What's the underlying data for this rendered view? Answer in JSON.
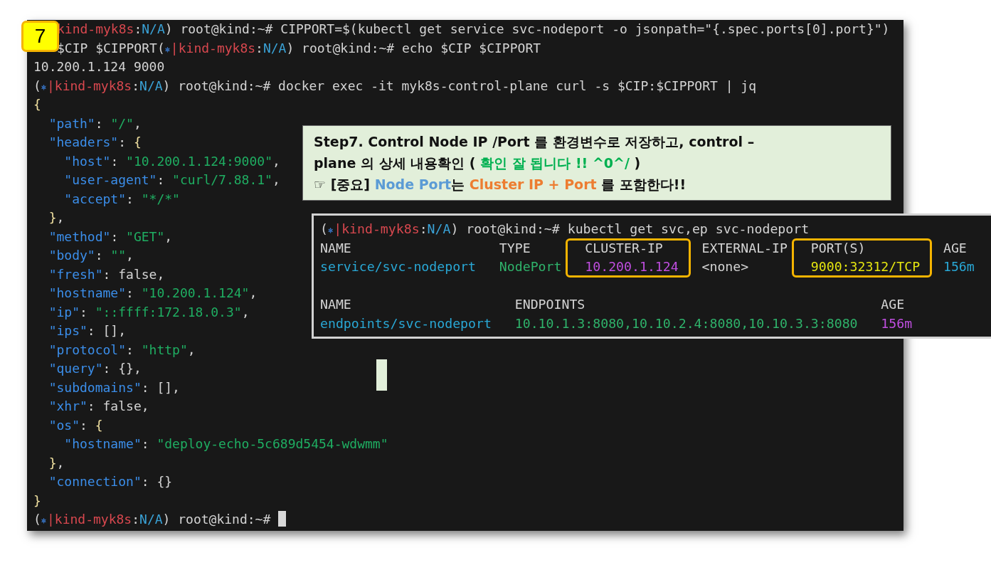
{
  "badge": {
    "text": "7"
  },
  "terminal": {
    "lines": [
      {
        "segments": [
          {
            "kind": "context",
            "text": "kind-myk8s"
          },
          {
            "kind": "plain",
            "text": ":"
          },
          {
            "kind": "ns",
            "text": "N/A"
          },
          {
            "kind": "plain",
            "text": ") root@kind:~# CIPPORT=$(kubectl get service svc-nodeport -o jsonpath=\"{.spec.ports[0].port}\")"
          }
        ]
      },
      {
        "segments": [
          {
            "kind": "plain",
            "text": "$CIP $CIPPORT("
          },
          {
            "kind": "helm",
            "text": "⎈"
          },
          {
            "kind": "sep",
            "text": "|"
          },
          {
            "kind": "context",
            "text": "kind-myk8s"
          },
          {
            "kind": "plain",
            "text": ":"
          },
          {
            "kind": "ns",
            "text": "N/A"
          },
          {
            "kind": "plain",
            "text": ") root@kind:~# echo $CIP $CIPPORT"
          }
        ]
      },
      {
        "segments": [
          {
            "kind": "plain",
            "text": "10.200.1.124 9000"
          }
        ]
      },
      {
        "segments": [
          {
            "kind": "plain",
            "text": "("
          },
          {
            "kind": "helm",
            "text": "⎈"
          },
          {
            "kind": "sep",
            "text": "|"
          },
          {
            "kind": "context",
            "text": "kind-myk8s"
          },
          {
            "kind": "plain",
            "text": ":"
          },
          {
            "kind": "ns",
            "text": "N/A"
          },
          {
            "kind": "plain",
            "text": ") root@kind:~# docker exec -it myk8s-control-plane curl -s $CIP:$CIPPORT | jq"
          }
        ]
      },
      {
        "segments": [
          {
            "kind": "brace",
            "text": "{"
          }
        ]
      },
      {
        "segments": [
          {
            "kind": "key",
            "text": "  \"path\""
          },
          {
            "kind": "plain",
            "text": ": "
          },
          {
            "kind": "string",
            "text": "\"/\""
          },
          {
            "kind": "plain",
            "text": ","
          }
        ]
      },
      {
        "segments": [
          {
            "kind": "key",
            "text": "  \"headers\""
          },
          {
            "kind": "plain",
            "text": ": "
          },
          {
            "kind": "brace",
            "text": "{"
          }
        ]
      },
      {
        "segments": [
          {
            "kind": "key",
            "text": "    \"host\""
          },
          {
            "kind": "plain",
            "text": ": "
          },
          {
            "kind": "string",
            "text": "\"10.200.1.124:9000\""
          },
          {
            "kind": "plain",
            "text": ","
          }
        ]
      },
      {
        "segments": [
          {
            "kind": "key",
            "text": "    \"user-agent\""
          },
          {
            "kind": "plain",
            "text": ": "
          },
          {
            "kind": "string",
            "text": "\"curl/7.88.1\""
          },
          {
            "kind": "plain",
            "text": ","
          }
        ]
      },
      {
        "segments": [
          {
            "kind": "key",
            "text": "    \"accept\""
          },
          {
            "kind": "plain",
            "text": ": "
          },
          {
            "kind": "string",
            "text": "\"*/*\""
          }
        ]
      },
      {
        "segments": [
          {
            "kind": "brace",
            "text": "  }"
          },
          {
            "kind": "plain",
            "text": ","
          }
        ]
      },
      {
        "segments": [
          {
            "kind": "key",
            "text": "  \"method\""
          },
          {
            "kind": "plain",
            "text": ": "
          },
          {
            "kind": "string",
            "text": "\"GET\""
          },
          {
            "kind": "plain",
            "text": ","
          }
        ]
      },
      {
        "segments": [
          {
            "kind": "key",
            "text": "  \"body\""
          },
          {
            "kind": "plain",
            "text": ": "
          },
          {
            "kind": "string",
            "text": "\"\""
          },
          {
            "kind": "plain",
            "text": ","
          }
        ]
      },
      {
        "segments": [
          {
            "kind": "key",
            "text": "  \"fresh\""
          },
          {
            "kind": "plain",
            "text": ": false,"
          }
        ]
      },
      {
        "segments": [
          {
            "kind": "key",
            "text": "  \"hostname\""
          },
          {
            "kind": "plain",
            "text": ": "
          },
          {
            "kind": "string",
            "text": "\"10.200.1.124\""
          },
          {
            "kind": "plain",
            "text": ","
          }
        ]
      },
      {
        "segments": [
          {
            "kind": "key",
            "text": "  \"ip\""
          },
          {
            "kind": "plain",
            "text": ": "
          },
          {
            "kind": "string",
            "text": "\"::ffff:172.18.0.3\""
          },
          {
            "kind": "plain",
            "text": ","
          }
        ]
      },
      {
        "segments": [
          {
            "kind": "key",
            "text": "  \"ips\""
          },
          {
            "kind": "plain",
            "text": ": [],"
          }
        ]
      },
      {
        "segments": [
          {
            "kind": "key",
            "text": "  \"protocol\""
          },
          {
            "kind": "plain",
            "text": ": "
          },
          {
            "kind": "string",
            "text": "\"http\""
          },
          {
            "kind": "plain",
            "text": ","
          }
        ]
      },
      {
        "segments": [
          {
            "kind": "key",
            "text": "  \"query\""
          },
          {
            "kind": "plain",
            "text": ": {},"
          }
        ]
      },
      {
        "segments": [
          {
            "kind": "key",
            "text": "  \"subdomains\""
          },
          {
            "kind": "plain",
            "text": ": [],"
          }
        ]
      },
      {
        "segments": [
          {
            "kind": "key",
            "text": "  \"xhr\""
          },
          {
            "kind": "plain",
            "text": ": false,"
          }
        ]
      },
      {
        "segments": [
          {
            "kind": "key",
            "text": "  \"os\""
          },
          {
            "kind": "plain",
            "text": ": "
          },
          {
            "kind": "brace",
            "text": "{"
          }
        ]
      },
      {
        "segments": [
          {
            "kind": "key",
            "text": "    \"hostname\""
          },
          {
            "kind": "plain",
            "text": ": "
          },
          {
            "kind": "string",
            "text": "\"deploy-echo-5c689d5454-wdwmm\""
          }
        ]
      },
      {
        "segments": [
          {
            "kind": "brace",
            "text": "  }"
          },
          {
            "kind": "plain",
            "text": ","
          }
        ]
      },
      {
        "segments": [
          {
            "kind": "key",
            "text": "  \"connection\""
          },
          {
            "kind": "plain",
            "text": ": {}"
          }
        ]
      },
      {
        "segments": [
          {
            "kind": "brace",
            "text": "}"
          }
        ]
      },
      {
        "segments": [
          {
            "kind": "plain",
            "text": "("
          },
          {
            "kind": "helm",
            "text": "⎈"
          },
          {
            "kind": "sep",
            "text": "|"
          },
          {
            "kind": "context",
            "text": "kind-myk8s"
          },
          {
            "kind": "plain",
            "text": ":"
          },
          {
            "kind": "ns",
            "text": "N/A"
          },
          {
            "kind": "plain",
            "text": ") root@kind:~#"
          },
          {
            "kind": "cursor"
          }
        ]
      }
    ]
  },
  "note": {
    "paragraph": [
      {
        "kind": "plain",
        "text": "Step7. Control Node IP /Port 를 환경변수로 저장하고, control –"
      },
      {
        "kind": "br"
      },
      {
        "kind": "plain",
        "text": "plane 의 상세 내용확인 ( "
      },
      {
        "kind": "green",
        "text": "확인 잘 됩니다 !! ^0^/"
      },
      {
        "kind": "plain",
        "text": " )"
      }
    ],
    "important": [
      {
        "kind": "plain",
        "text": "☞ [중요]  "
      },
      {
        "kind": "blue",
        "text": "Node Port"
      },
      {
        "kind": "plain",
        "text": "는 "
      },
      {
        "kind": "orange",
        "text": "Cluster IP + Port"
      },
      {
        "kind": "plain",
        "text": " 를 포함한다!!"
      }
    ]
  },
  "kubectl": {
    "prompt": [
      {
        "kind": "plain",
        "text": "("
      },
      {
        "kind": "helm",
        "text": "⎈"
      },
      {
        "kind": "sep",
        "text": "|"
      },
      {
        "kind": "context",
        "text": "kind-myk8s"
      },
      {
        "kind": "plain",
        "text": ":"
      },
      {
        "kind": "ns",
        "text": "N/A"
      },
      {
        "kind": "plain",
        "text": ") root@kind:~# kubectl get svc,ep svc-nodeport"
      }
    ],
    "tables": [
      {
        "columns": [
          {
            "label": "NAME",
            "highlighted": false
          },
          {
            "label": "TYPE",
            "highlighted": false
          },
          {
            "label": "CLUSTER-IP",
            "highlighted": true
          },
          {
            "label": "EXTERNAL-IP",
            "highlighted": false
          },
          {
            "label": "PORT(S)",
            "highlighted": true
          },
          {
            "label": "AGE",
            "highlighted": false
          }
        ],
        "rows": [
          [
            {
              "kind": "name",
              "text": "service/svc-nodeport"
            },
            {
              "kind": "type",
              "text": "NodePort"
            },
            {
              "kind": "ip",
              "text": "10.200.1.124"
            },
            {
              "kind": "plain",
              "text": "<none>"
            },
            {
              "kind": "port",
              "text": "9000:32312/TCP"
            },
            {
              "kind": "age",
              "text": "156m"
            }
          ]
        ]
      },
      {
        "columns": [
          {
            "label": "NAME",
            "highlighted": false
          },
          {
            "label": "ENDPOINTS",
            "highlighted": false
          },
          {
            "label": "AGE",
            "highlighted": false
          }
        ],
        "rows": [
          [
            {
              "kind": "name",
              "text": "endpoints/svc-nodeport"
            },
            {
              "kind": "type",
              "text": "10.10.1.3:8080,10.10.2.4:8080,10.10.3.3:8080"
            },
            {
              "kind": "ip",
              "text": "156m"
            }
          ]
        ]
      }
    ]
  }
}
